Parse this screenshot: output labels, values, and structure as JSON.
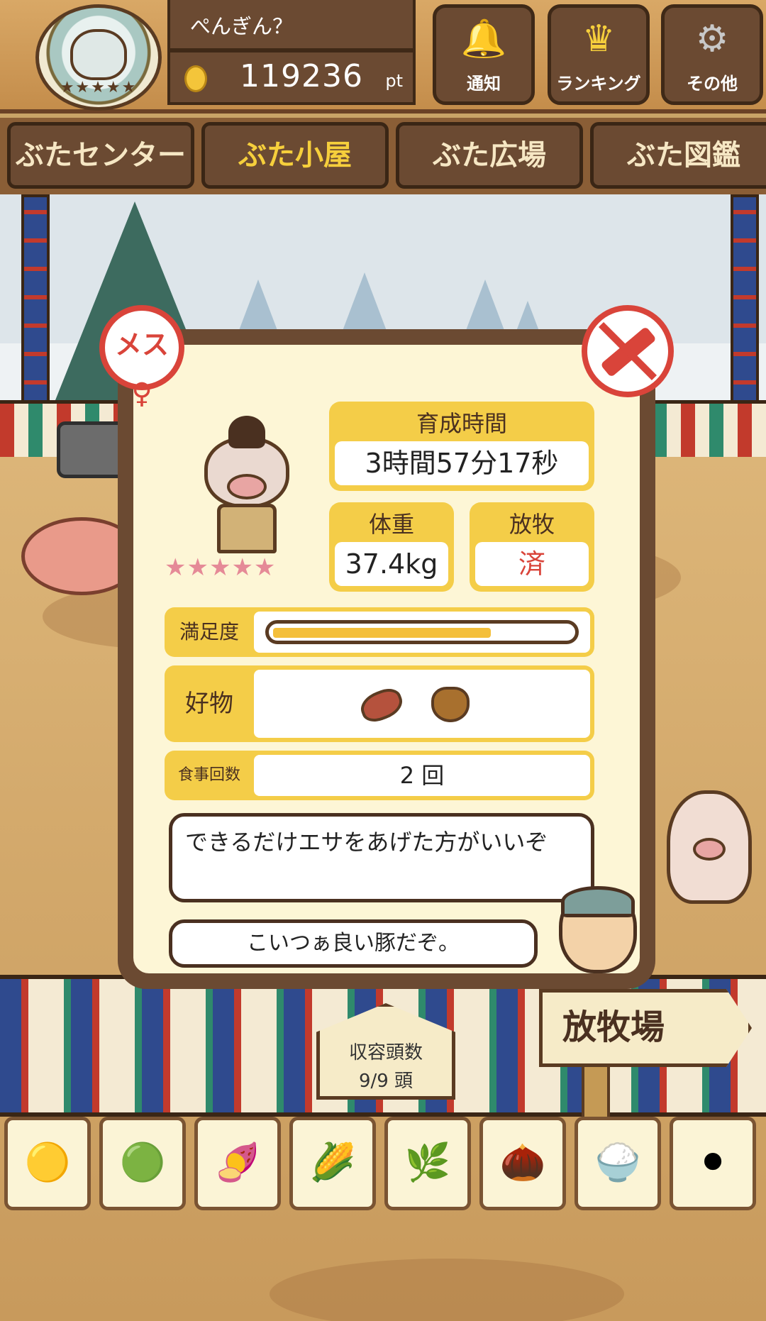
{
  "header": {
    "player_name": "ぺんぎん？",
    "points": "119236",
    "points_unit": "pt",
    "buttons": {
      "notice": "通知",
      "ranking": "ランキング",
      "other": "その他"
    }
  },
  "tabs": {
    "center": "ぶたセンター",
    "hut": "ぶた小屋",
    "plaza": "ぶた広場",
    "book": "ぶた図鑑"
  },
  "active_tab": "hut",
  "pig_info": {
    "gender": "メス",
    "gender_symbol": "♀",
    "rating": "★★★★★",
    "rating_value": 5,
    "raise_time_label": "育成時間",
    "raise_time_value": "3時間57分17秒",
    "weight_label": "体重",
    "weight_value": "37.4kg",
    "grazing_label": "放牧",
    "grazing_value": "済",
    "satisfaction_label": "満足度",
    "satisfaction_fraction": 0.73,
    "favorite_label": "好物",
    "meals_label": "食事回数",
    "meals_value": "2 回",
    "advice": "できるだけエサをあげた方がいいぞ",
    "comment": "こいつぁ良い豚だぞ。"
  },
  "farm": {
    "capacity_label": "収容頭数",
    "capacity_value": "9/9 頭",
    "pasture_sign": "放牧場"
  },
  "colors": {
    "accent_yellow": "#f4cd48",
    "wood_dark": "#6b4a32",
    "alert_red": "#d9443a"
  }
}
